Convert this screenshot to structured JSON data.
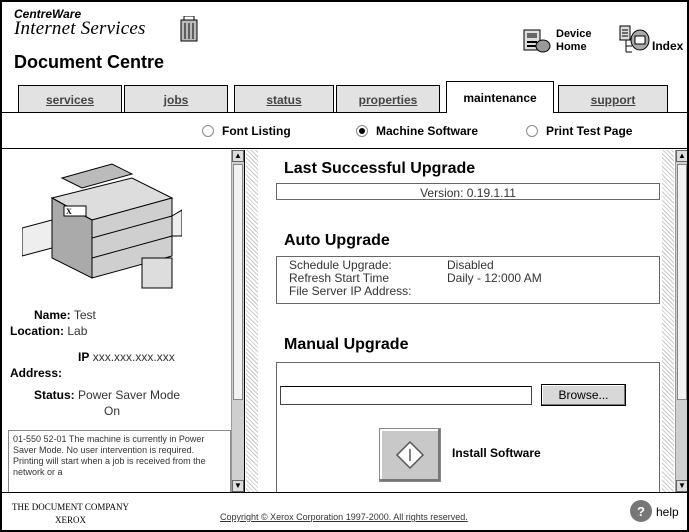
{
  "header": {
    "brand_top": "CentreWare",
    "brand_sub": "Internet Services",
    "product": "Document Centre",
    "device_home_line1": "Device",
    "device_home_line2": "Home",
    "index": "Index"
  },
  "tabs": [
    {
      "label": "services",
      "active": false
    },
    {
      "label": "jobs",
      "active": false
    },
    {
      "label": "status",
      "active": false
    },
    {
      "label": "properties",
      "active": false
    },
    {
      "label": "maintenance",
      "active": true
    },
    {
      "label": "support",
      "active": false
    }
  ],
  "subnav": [
    {
      "label": "Font Listing",
      "selected": false
    },
    {
      "label": "Machine Software",
      "selected": true
    },
    {
      "label": "Print Test Page",
      "selected": false
    }
  ],
  "device": {
    "name_label": "Name:",
    "name_value": "Test",
    "location_label": "Location:",
    "location_value": "Lab",
    "ip_label_1": "IP",
    "ip_label_2": "Address:",
    "ip_value": "xxx.xxx.xxx.xxx",
    "status_label": "Status:",
    "status_value_1": "Power Saver Mode",
    "status_value_2": "On",
    "status_message": "01-550 52-01 The machine is currently in Power Saver Mode. No user intervention is required. Printing will start when a job is received from the network or a"
  },
  "upgrade": {
    "last_title": "Last Successful Upgrade",
    "version": "Version: 0.19.1.11",
    "auto_title": "Auto Upgrade",
    "schedule_label": "Schedule Upgrade:",
    "schedule_value": "Disabled",
    "refresh_label": "Refresh Start Time",
    "refresh_value": "Daily - 12:000 AM",
    "fileserver_label": "File Server IP Address:",
    "fileserver_value": "",
    "manual_title": "Manual Upgrade",
    "file_value": "",
    "browse_label": "Browse...",
    "install_label": "Install Software"
  },
  "footer": {
    "company_line1": "THE DOCUMENT COMPANY",
    "company_line2": "XEROX",
    "copyright": "Copyright © Xerox Corporation 1997-2000. All rights reserved.",
    "help": "help"
  }
}
